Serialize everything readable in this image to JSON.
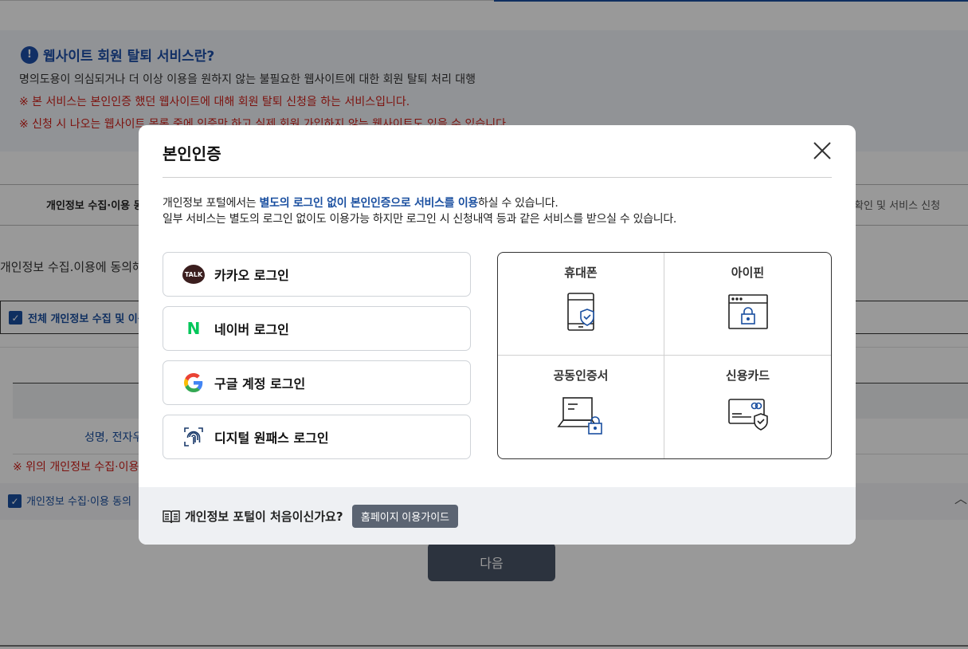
{
  "background": {
    "intro": {
      "title": "웹사이트 회원 탈퇴 서비스란?",
      "desc": "명의도용이 의심되거나 더 이상 이용을 원하지 않는 불필요한 웹사이트에 대한 회원 탈퇴 처리 대행",
      "warn1": "※ 본 서비스는 본인인증 했던 웹사이트에 대해 회원 탈퇴 신청을 하는 서비스입니다.",
      "warn2": "※ 신청 시 나오는 웹사이트 목록 중에 인증만 하고 실제 회원 가입하지 않는 웹사이트도 있을 수 있습니다."
    },
    "steps": {
      "step1": "개인정보 수집·이용 동",
      "step3": "확인 및 서비스 신청"
    },
    "consent_text": "개인정보 수집.이용에 동의해",
    "all_agree_label": "전체 개인정보 수집 및 이용",
    "table_cell": "성명, 전자우",
    "warn_bottom": "※ 위의 개인정보 수집·이용",
    "agree_label": "개인정보 수집·이용 동의",
    "next_button": "다음"
  },
  "modal": {
    "title": "본인인증",
    "desc1_prefix": "개인정보 포털에서는 ",
    "desc1_highlight": "별도의 로그인 없이 본인인증으로 서비스를 이용",
    "desc1_suffix": "하실 수 있습니다.",
    "desc2": "일부 서비스는 별도의 로그인 없이도 이용가능 하지만 로그인 시 신청내역 등과 같은 서비스를 받으실 수 있습니다.",
    "logins": [
      {
        "label": "카카오 로그인",
        "icon": "kakao-talk-icon",
        "icon_text": "TALK"
      },
      {
        "label": "네이버 로그인",
        "icon": "naver-icon",
        "icon_text": "N"
      },
      {
        "label": "구글 계정 로그인",
        "icon": "google-icon"
      },
      {
        "label": "디지털 원패스 로그인",
        "icon": "fingerprint-icon"
      }
    ],
    "auth_methods": [
      {
        "label": "휴대폰",
        "icon": "mobile-phone-shield-icon"
      },
      {
        "label": "아이핀",
        "icon": "ipin-browser-lock-icon"
      },
      {
        "label": "공동인증서",
        "icon": "certificate-laptop-lock-icon"
      },
      {
        "label": "신용카드",
        "icon": "credit-card-shield-icon"
      }
    ],
    "footer": {
      "question": "개인정보 포털이 처음이신가요?",
      "guide_button": "홈페이지 이용가이드"
    }
  },
  "colors": {
    "accent": "#1a4fa0",
    "warning": "#d0201a",
    "naver_green": "#03c75a",
    "kakao_dark": "#3b1e1e"
  }
}
